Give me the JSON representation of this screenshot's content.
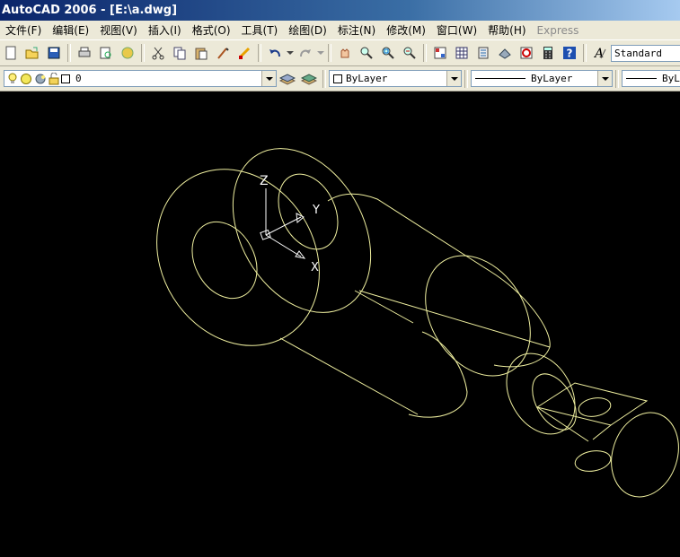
{
  "window": {
    "title": "AutoCAD 2006 - [E:\\a.dwg]"
  },
  "menu": [
    {
      "label": "文件(F)",
      "enabled": true
    },
    {
      "label": "编辑(E)",
      "enabled": true
    },
    {
      "label": "视图(V)",
      "enabled": true
    },
    {
      "label": "插入(I)",
      "enabled": true
    },
    {
      "label": "格式(O)",
      "enabled": true
    },
    {
      "label": "工具(T)",
      "enabled": true
    },
    {
      "label": "绘图(D)",
      "enabled": true
    },
    {
      "label": "标注(N)",
      "enabled": true
    },
    {
      "label": "修改(M)",
      "enabled": true
    },
    {
      "label": "窗口(W)",
      "enabled": true
    },
    {
      "label": "帮助(H)",
      "enabled": true
    },
    {
      "label": "Express",
      "enabled": false
    }
  ],
  "toolbar": {
    "text_style": "Standard",
    "layer": "0",
    "color": "ByLayer",
    "linetype": "ByLayer",
    "lineweight": "ByLa"
  },
  "ucs": {
    "z_label": "Z",
    "y_label": "Y",
    "x_label": "X"
  },
  "colors": {
    "drawing_lines": "#f0f0a0",
    "ucs_icon": "#ffffff",
    "background": "#000000"
  }
}
